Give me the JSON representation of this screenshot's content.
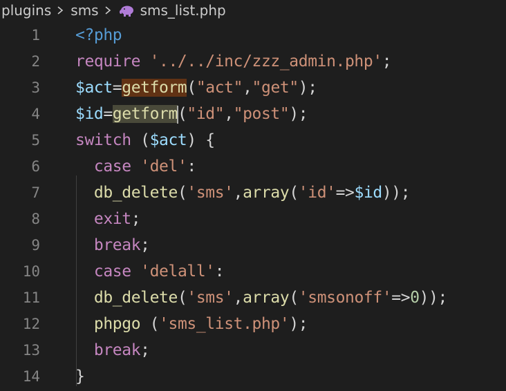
{
  "breadcrumb": {
    "items": [
      "plugins",
      "sms",
      "sms_list.php"
    ],
    "file_icon": "php-elephant-icon",
    "file_icon_color": "#b07cd8"
  },
  "editor": {
    "line_numbers": [
      "1",
      "2",
      "3",
      "4",
      "5",
      "6",
      "7",
      "8",
      "9",
      "10",
      "11",
      "12",
      "13",
      "14"
    ],
    "lines": [
      [
        {
          "t": "<?php",
          "c": "tag"
        }
      ],
      [
        {
          "t": "require",
          "c": "kw"
        },
        {
          "t": " ",
          "c": "plain"
        },
        {
          "t": "'../../inc/zzz_admin.php'",
          "c": "str"
        },
        {
          "t": ";",
          "c": "plain"
        }
      ],
      [
        {
          "t": "$act",
          "c": "var"
        },
        {
          "t": "=",
          "c": "plain"
        },
        {
          "t": "getform",
          "c": "fn hl1"
        },
        {
          "t": "(",
          "c": "plain"
        },
        {
          "t": "\"act\"",
          "c": "str"
        },
        {
          "t": ",",
          "c": "plain"
        },
        {
          "t": "\"get\"",
          "c": "str"
        },
        {
          "t": ");",
          "c": "plain"
        }
      ],
      [
        {
          "t": "$id",
          "c": "var"
        },
        {
          "t": "=",
          "c": "plain"
        },
        {
          "t": "getform",
          "c": "fn hl2"
        },
        {
          "t": "|",
          "c": "cursor"
        },
        {
          "t": "(",
          "c": "plain"
        },
        {
          "t": "\"id\"",
          "c": "str"
        },
        {
          "t": ",",
          "c": "plain"
        },
        {
          "t": "\"post\"",
          "c": "str"
        },
        {
          "t": ");",
          "c": "plain"
        }
      ],
      [
        {
          "t": "switch",
          "c": "kw"
        },
        {
          "t": " (",
          "c": "plain"
        },
        {
          "t": "$act",
          "c": "var"
        },
        {
          "t": ") {",
          "c": "plain"
        }
      ],
      [
        {
          "t": "  ",
          "c": "plain"
        },
        {
          "t": "case",
          "c": "kw"
        },
        {
          "t": " ",
          "c": "plain"
        },
        {
          "t": "'del'",
          "c": "str"
        },
        {
          "t": ":",
          "c": "plain"
        }
      ],
      [
        {
          "t": "  ",
          "c": "plain"
        },
        {
          "t": "db_delete",
          "c": "fn"
        },
        {
          "t": "(",
          "c": "plain"
        },
        {
          "t": "'sms'",
          "c": "str"
        },
        {
          "t": ",",
          "c": "plain"
        },
        {
          "t": "array",
          "c": "fn"
        },
        {
          "t": "(",
          "c": "plain"
        },
        {
          "t": "'id'",
          "c": "str"
        },
        {
          "t": "=>",
          "c": "plain"
        },
        {
          "t": "$id",
          "c": "var"
        },
        {
          "t": "));",
          "c": "plain"
        }
      ],
      [
        {
          "t": "  ",
          "c": "plain"
        },
        {
          "t": "exit",
          "c": "kw"
        },
        {
          "t": ";",
          "c": "plain"
        }
      ],
      [
        {
          "t": "  ",
          "c": "plain"
        },
        {
          "t": "break",
          "c": "kw"
        },
        {
          "t": ";",
          "c": "plain"
        }
      ],
      [
        {
          "t": "  ",
          "c": "plain"
        },
        {
          "t": "case",
          "c": "kw"
        },
        {
          "t": " ",
          "c": "plain"
        },
        {
          "t": "'delall'",
          "c": "str"
        },
        {
          "t": ":",
          "c": "plain"
        }
      ],
      [
        {
          "t": "  ",
          "c": "plain"
        },
        {
          "t": "db_delete",
          "c": "fn"
        },
        {
          "t": "(",
          "c": "plain"
        },
        {
          "t": "'sms'",
          "c": "str"
        },
        {
          "t": ",",
          "c": "plain"
        },
        {
          "t": "array",
          "c": "fn"
        },
        {
          "t": "(",
          "c": "plain"
        },
        {
          "t": "'smsonoff'",
          "c": "str"
        },
        {
          "t": "=>",
          "c": "plain"
        },
        {
          "t": "0",
          "c": "num"
        },
        {
          "t": "));",
          "c": "plain"
        }
      ],
      [
        {
          "t": "  ",
          "c": "plain"
        },
        {
          "t": "phpgo",
          "c": "fn"
        },
        {
          "t": " (",
          "c": "plain"
        },
        {
          "t": "'sms_list.php'",
          "c": "str"
        },
        {
          "t": ");",
          "c": "plain"
        }
      ],
      [
        {
          "t": "  ",
          "c": "plain"
        },
        {
          "t": "break",
          "c": "kw"
        },
        {
          "t": ";",
          "c": "plain"
        }
      ],
      [
        {
          "t": "}",
          "c": "plain"
        }
      ]
    ]
  }
}
